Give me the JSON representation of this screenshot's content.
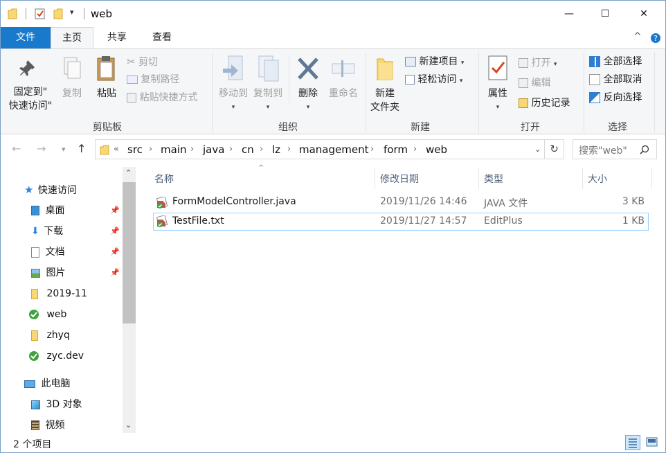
{
  "window": {
    "title": "web",
    "controls": {
      "minimize": "—",
      "maximize": "☐",
      "close": "✕"
    }
  },
  "tabs": [
    {
      "label": "文件"
    },
    {
      "label": "主页"
    },
    {
      "label": "共享"
    },
    {
      "label": "查看"
    }
  ],
  "ribbon": {
    "clipboard": {
      "label": "剪贴板",
      "pin_line1": "固定到\"",
      "pin_line2": "快速访问\"",
      "copy": "复制",
      "paste": "粘贴",
      "cut": "剪切",
      "copy_path": "复制路径",
      "paste_shortcut": "粘贴快捷方式"
    },
    "organize": {
      "label": "组织",
      "move_to": "移动到",
      "copy_to": "复制到",
      "delete": "删除",
      "rename": "重命名"
    },
    "new": {
      "label": "新建",
      "new_folder_line1": "新建",
      "new_folder_line2": "文件夹",
      "new_item": "新建项目",
      "easy_access": "轻松访问"
    },
    "open": {
      "label": "打开",
      "properties": "属性",
      "open": "打开",
      "edit": "编辑",
      "history": "历史记录"
    },
    "select": {
      "label": "选择",
      "select_all": "全部选择",
      "select_none": "全部取消",
      "invert": "反向选择"
    }
  },
  "address": {
    "overflow": "«",
    "crumbs": [
      "src",
      "main",
      "java",
      "cn",
      "lz",
      "management",
      "form",
      "web"
    ],
    "search_placeholder": "搜索\"web\""
  },
  "nav": {
    "quick_access": "快速访问",
    "items": [
      {
        "label": "桌面",
        "pinned": true
      },
      {
        "label": "下载",
        "pinned": true
      },
      {
        "label": "文档",
        "pinned": true
      },
      {
        "label": "图片",
        "pinned": true
      },
      {
        "label": "2019-11",
        "pinned": false
      },
      {
        "label": "web",
        "pinned": false
      },
      {
        "label": "zhyq",
        "pinned": false
      },
      {
        "label": "zyc.dev",
        "pinned": false
      }
    ],
    "this_pc": "此电脑",
    "pc_items": [
      {
        "label": "3D 对象"
      },
      {
        "label": "视频"
      }
    ]
  },
  "columns": {
    "name": "名称",
    "modified": "修改日期",
    "type": "类型",
    "size": "大小"
  },
  "files": [
    {
      "name": "FormModelController.java",
      "modified": "2019/11/26 14:46",
      "type": "JAVA 文件",
      "size": "3 KB"
    },
    {
      "name": "TestFile.txt",
      "modified": "2019/11/27 14:57",
      "type": "EditPlus",
      "size": "1 KB"
    }
  ],
  "status": {
    "count": "2 个项目"
  },
  "colors": {
    "accent": "#1979ca",
    "selection_border": "#99d1ff",
    "folder": "#f8d775"
  }
}
